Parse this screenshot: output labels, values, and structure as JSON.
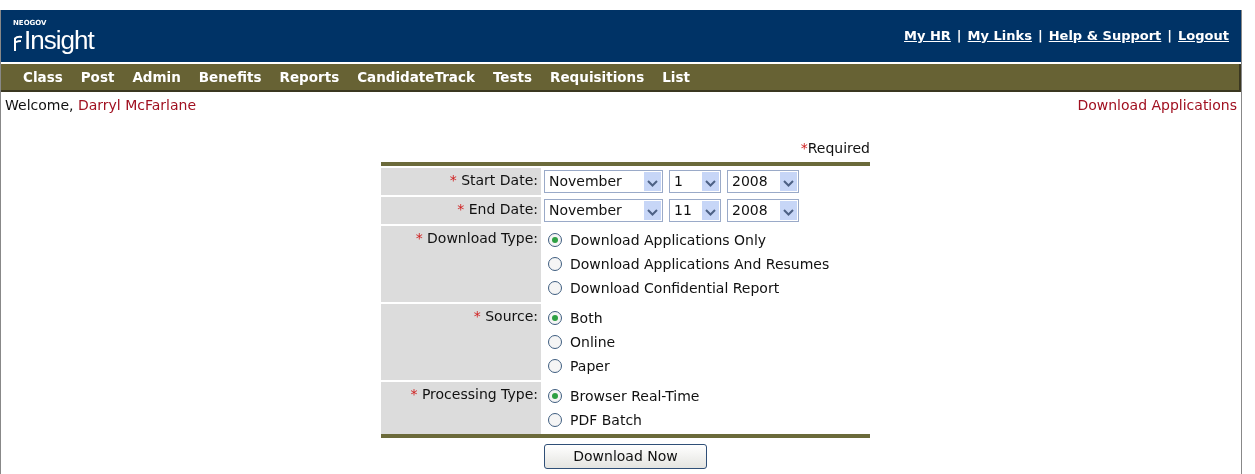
{
  "header": {
    "logo_small": "NEOGOV",
    "logo_main": "Insight",
    "links": [
      {
        "label": "My HR"
      },
      {
        "label": "My Links"
      },
      {
        "label": "Help & Support"
      },
      {
        "label": "Logout"
      }
    ],
    "separator": "|"
  },
  "menu": [
    {
      "label": "Class"
    },
    {
      "label": "Post"
    },
    {
      "label": "Admin"
    },
    {
      "label": "Benefits"
    },
    {
      "label": "Reports"
    },
    {
      "label": "CandidateTrack"
    },
    {
      "label": "Tests"
    },
    {
      "label": "Requisitions"
    },
    {
      "label": "List"
    }
  ],
  "welcome": {
    "text": "Welcome,",
    "user": "Darryl McFarlane"
  },
  "page_title": "Download Applications",
  "required_note": {
    "mark": "*",
    "text": "Required"
  },
  "fields": [
    {
      "kind": "date",
      "mark": "*",
      "label": "Start Date:",
      "month": "November",
      "day": "1",
      "year": "2008"
    },
    {
      "kind": "date",
      "mark": "*",
      "label": "End Date:",
      "month": "November",
      "day": "11",
      "year": "2008"
    },
    {
      "kind": "radio",
      "mark": "*",
      "label": "Download Type:",
      "options": [
        {
          "label": "Download Applications Only",
          "selected": true
        },
        {
          "label": "Download Applications And Resumes",
          "selected": false
        },
        {
          "label": "Download Confidential Report",
          "selected": false
        }
      ]
    },
    {
      "kind": "radio",
      "mark": "*",
      "label": "Source:",
      "options": [
        {
          "label": "Both",
          "selected": true
        },
        {
          "label": "Online",
          "selected": false
        },
        {
          "label": "Paper",
          "selected": false
        }
      ]
    },
    {
      "kind": "radio",
      "mark": "*",
      "label": "Processing Type:",
      "options": [
        {
          "label": "Browser Real-Time",
          "selected": true
        },
        {
          "label": "PDF Batch",
          "selected": false
        }
      ]
    }
  ],
  "submit": "Download Now"
}
